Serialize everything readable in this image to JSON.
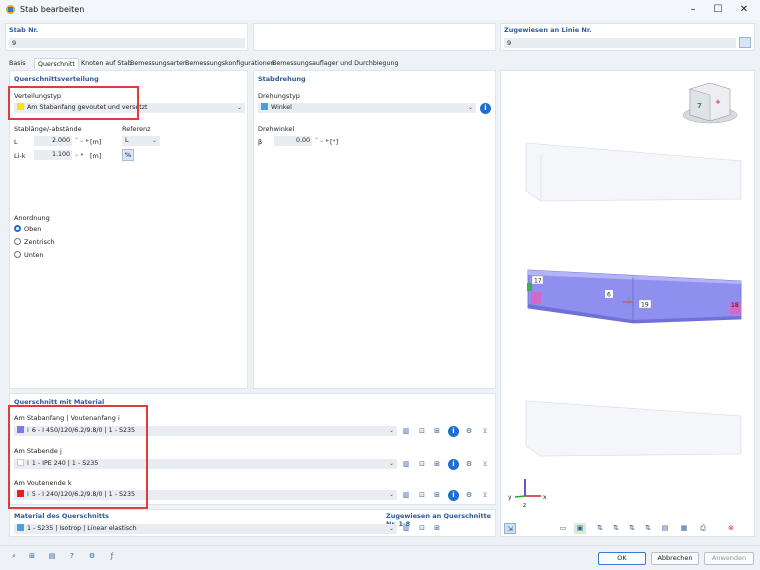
{
  "window": {
    "title": "Stab bearbeiten",
    "minimize": "–",
    "maximize": "☐",
    "close": "✕"
  },
  "header": {
    "stab_nr_label": "Stab Nr.",
    "stab_nr_value": "9",
    "linie_label": "Zugewiesen an Linie Nr.",
    "linie_value": "9"
  },
  "tabs": [
    {
      "label": "Basis"
    },
    {
      "label": "Querschnitt"
    },
    {
      "label": "Knoten auf Stab"
    },
    {
      "label": "Bemessungsarten"
    },
    {
      "label": "Bemessungskonfigurationen"
    },
    {
      "label": "Bemessungsauflager und Durchbiegung"
    }
  ],
  "qv": {
    "title": "Querschnittsverteilung",
    "verteilungstyp_label": "Verteilungstyp",
    "verteilungstyp_value": "Am Stabanfang gevoutet und versetzt",
    "verteilungstyp_color": "#f2e51c",
    "stablaenge_label": "Stablänge/-abstände",
    "referenz_label": "Referenz",
    "L_label": "L",
    "L_value": "2.000",
    "L_unit": "[m]",
    "L_ref": "L",
    "Lk_label": "Li-k",
    "Lk_value": "1.100",
    "Lk_unit": "[m]",
    "percent": "%",
    "anordnung_label": "Anordnung",
    "options": [
      "Oben",
      "Zentrisch",
      "Unten"
    ],
    "selected": "Oben"
  },
  "sd": {
    "title": "Stabdrehung",
    "drehungstyp_label": "Drehungstyp",
    "drehungstyp_value": "Winkel",
    "drehungstyp_color": "#4a9fe0",
    "drehwinkel_label": "Drehwinkel",
    "beta_label": "β",
    "beta_value": "0.00",
    "beta_unit": "[°]"
  },
  "qm": {
    "title": "Querschnitt mit Material",
    "anfang_label": "Am Stabanfang | Voutenanfang i",
    "anfang_value": "6 - I 450/120/6.2/9.8/0 | 1 - S235",
    "anfang_color": "#7b7be8",
    "ende_label": "Am Stabende j",
    "ende_value": "1 - IPE 240 | 1 - S235",
    "ende_color": "#ffffff",
    "voute_label": "Am Voutenende k",
    "voute_value": "5 - I 240/120/6.2/9.8/0 | 1 - S235",
    "voute_color": "#ee1c1c"
  },
  "mat": {
    "title": "Material des Querschnitts",
    "assigned_label": "Zugewiesen an Querschnitte Nr. 1-8",
    "value": "1 - S235 | Isotrop | Linear elastisch",
    "color": "#4a9fe0"
  },
  "viewer": {
    "labels": {
      "n17": "17",
      "n6": "6",
      "n19": "19",
      "n18": "18",
      "axis_y": "y",
      "axis_x": "x",
      "axis_z": "z"
    },
    "cube_faces": {
      "front": "7",
      "side": "+"
    }
  },
  "footer": {
    "ok": "OK",
    "cancel": "Abbrechen",
    "apply": "Anwenden"
  }
}
